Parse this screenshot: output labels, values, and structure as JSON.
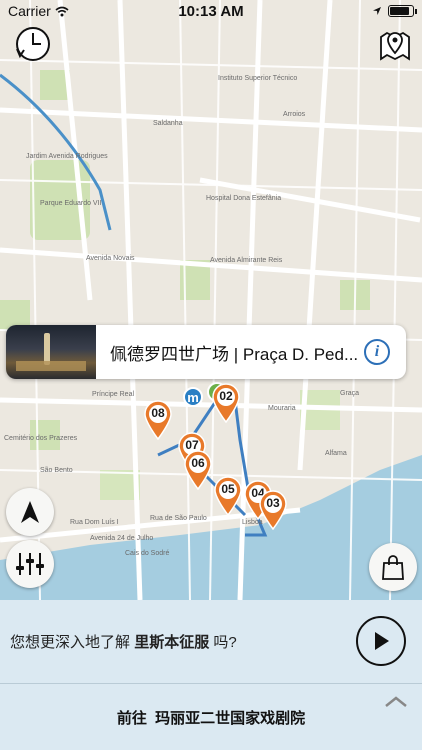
{
  "status_bar": {
    "carrier": "Carrier",
    "time": "10:13 AM"
  },
  "map": {
    "labels": [
      "Saldanha",
      "Arroios",
      "Instituto Superior Técnico",
      "Jardim Avenida Rodrigues",
      "Parque Eduardo VII",
      "Avenida Novais",
      "Hospital Dona Estefânia",
      "Avenida Almirante Reis",
      "Mouraria",
      "Graça",
      "Alfama",
      "Príncipe Real",
      "São Bento",
      "Cais do Sodré",
      "Rua de São Paulo",
      "Avenida 24 de Julho",
      "Rua Dom Luís I",
      "Cemitério dos Prazeres",
      "Lisboa"
    ],
    "pins": [
      {
        "label": "08"
      },
      {
        "label": "02"
      },
      {
        "label": "07"
      },
      {
        "label": "06"
      },
      {
        "label": "05"
      },
      {
        "label": "04"
      },
      {
        "label": "03"
      }
    ],
    "metro_label": "m"
  },
  "info_card": {
    "title": "佩德罗四世广场 | Praça D. Ped..."
  },
  "bottom": {
    "promo_prefix": "您想更深入地了解",
    "promo_highlight": "里斯本征服",
    "promo_suffix": "吗?",
    "navigate_prefix": "前往",
    "navigate_target": "玛丽亚二世国家戏剧院"
  },
  "colors": {
    "pin": "#e8792a",
    "route": "#3f7fc1",
    "metro": "#2a7fc4",
    "accent": "#2c6fb7"
  },
  "icons": [
    "history-clock-icon",
    "location-pin-icon",
    "compass-arrow-icon",
    "filter-sliders-icon",
    "shopping-bag-icon",
    "info-icon",
    "play-icon",
    "chevron-up-icon"
  ]
}
